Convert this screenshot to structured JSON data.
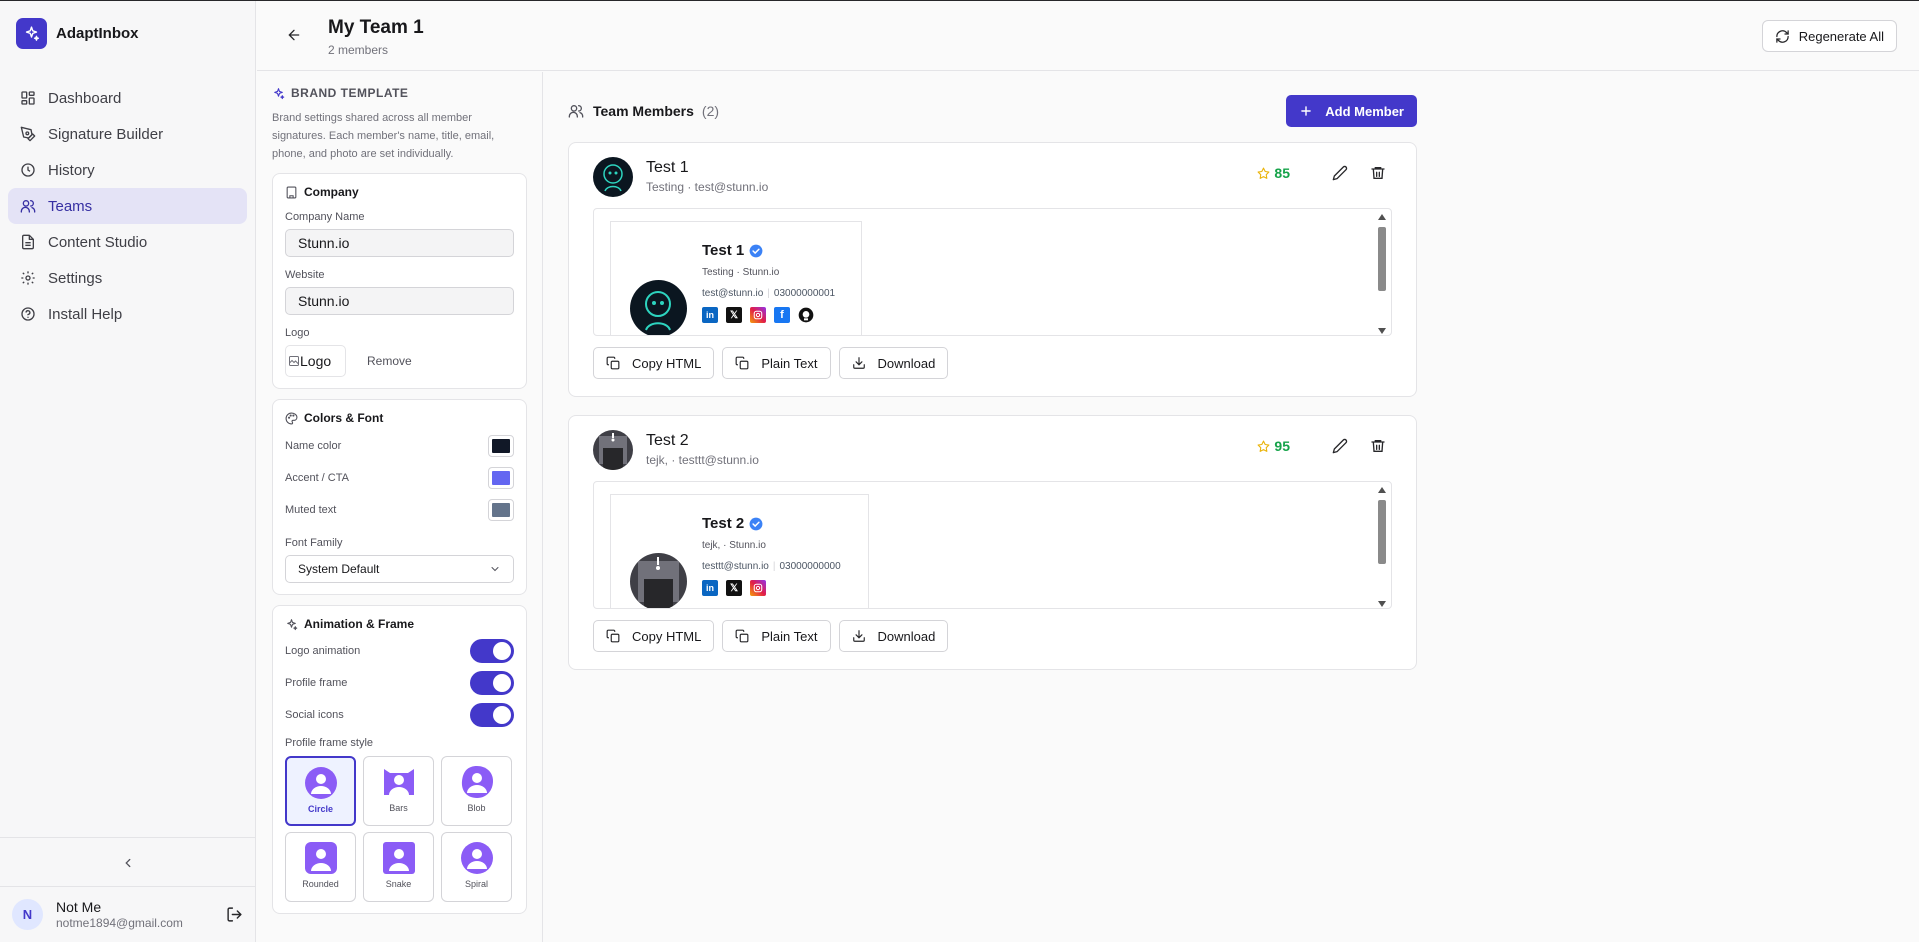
{
  "app": {
    "name": "AdaptInbox"
  },
  "nav": [
    {
      "label": "Dashboard",
      "icon": "grid-icon"
    },
    {
      "label": "Signature Builder",
      "icon": "pen-icon"
    },
    {
      "label": "History",
      "icon": "clock-icon"
    },
    {
      "label": "Teams",
      "icon": "users-icon",
      "active": true
    },
    {
      "label": "Content Studio",
      "icon": "document-icon"
    },
    {
      "label": "Settings",
      "icon": "gear-icon"
    },
    {
      "label": "Install Help",
      "icon": "help-icon"
    }
  ],
  "user": {
    "initial": "N",
    "name": "Not Me",
    "email": "notme1894@gmail.com"
  },
  "header": {
    "title": "My Team 1",
    "subtitle": "2 members",
    "regenerate_label": "Regenerate All"
  },
  "brand_template": {
    "heading": "BRAND TEMPLATE",
    "description": "Brand settings shared across all member signatures. Each member's name, title, email, phone, and photo are set individually.",
    "company": {
      "title": "Company",
      "company_name_label": "Company Name",
      "company_name_value": "Stunn.io",
      "website_label": "Website",
      "website_value": "Stunn.io",
      "logo_label": "Logo",
      "logo_alt": "Logo",
      "remove_label": "Remove"
    },
    "colors": {
      "title": "Colors & Font",
      "name_color_label": "Name color",
      "name_color": "#111827",
      "accent_label": "Accent / CTA",
      "accent_color": "#6366f1",
      "muted_label": "Muted text",
      "muted_color": "#64748b",
      "font_family_label": "Font Family",
      "font_family_value": "System Default"
    },
    "animation": {
      "title": "Animation & Frame",
      "logo_animation_label": "Logo animation",
      "logo_animation_on": true,
      "profile_frame_label": "Profile frame",
      "profile_frame_on": true,
      "social_icons_label": "Social icons",
      "social_icons_on": true,
      "frame_style_label": "Profile frame style",
      "frame_styles": [
        "Circle",
        "Bars",
        "Blob",
        "Rounded",
        "Snake",
        "Spiral"
      ],
      "selected_frame": "Circle"
    }
  },
  "members_section": {
    "title": "Team Members",
    "count": "(2)",
    "add_label": "Add Member"
  },
  "members": [
    {
      "name": "Test 1",
      "subtitle": "Testing · test@stunn.io",
      "score": "85",
      "sig_name": "Test 1",
      "sig_role": "Testing · Stunn.io",
      "sig_email": "test@stunn.io",
      "sig_phone": "03000000001",
      "socials": [
        "linkedin-icon",
        "x-icon",
        "instagram-icon",
        "facebook-icon",
        "github-icon"
      ]
    },
    {
      "name": "Test 2",
      "subtitle": "tejk, · testtt@stunn.io",
      "score": "95",
      "sig_name": "Test 2",
      "sig_role": "tejk, · Stunn.io",
      "sig_email": "testtt@stunn.io",
      "sig_phone": "03000000000",
      "socials": [
        "linkedin-icon",
        "x-icon",
        "instagram-icon"
      ]
    }
  ],
  "actions": {
    "copy_html": "Copy HTML",
    "plain_text": "Plain Text",
    "download": "Download"
  }
}
